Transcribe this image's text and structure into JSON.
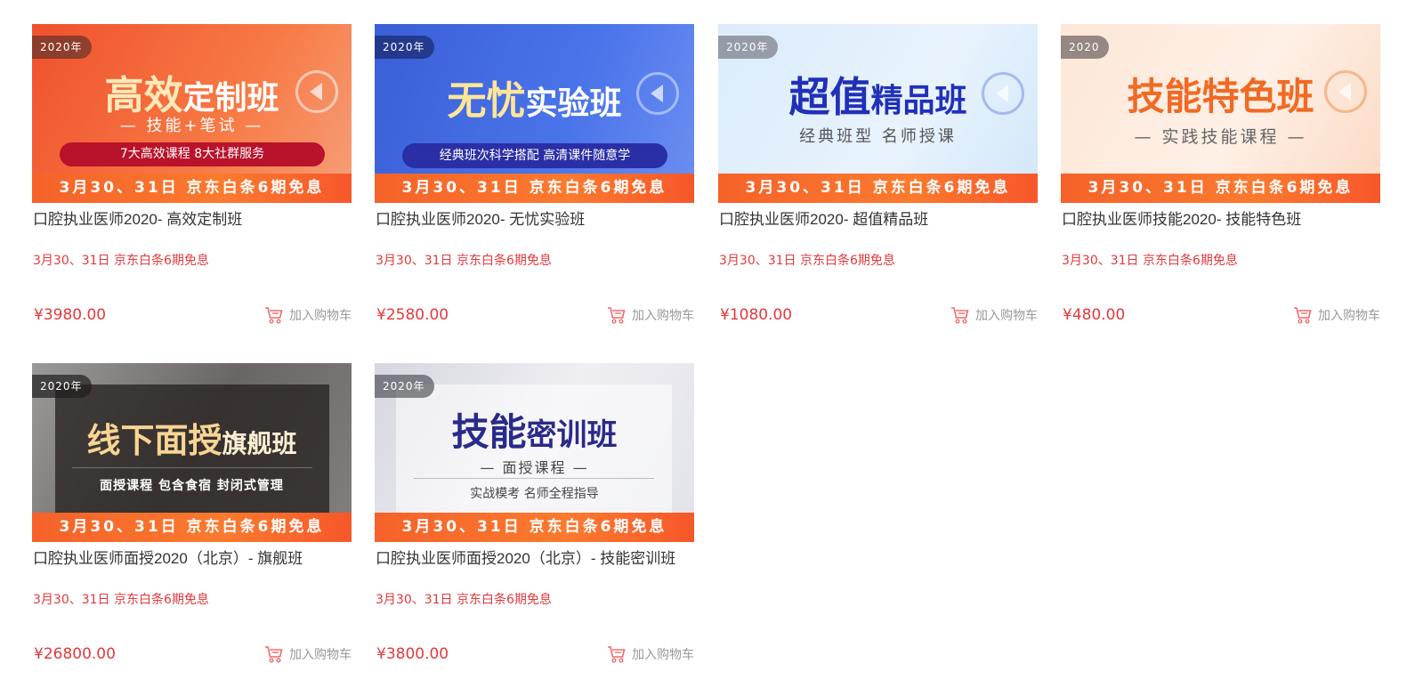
{
  "cards": [
    {
      "year": "2020年",
      "banner_main_a": "高效",
      "banner_main_b": "定制班",
      "banner_sub": "— 技能+笔试 —",
      "banner_pill": "7大高效课程  8大社群服务",
      "banner_promo": "3月30、31日 京东白条6期免息",
      "title": "口腔执业医师2020- 高效定制班",
      "promo": "3月30、31日 京东白条6期免息",
      "price": "¥3980.00",
      "cart": "加入购物车"
    },
    {
      "year": "2020年",
      "banner_main_a": "无忧",
      "banner_main_b": "实验班",
      "banner_pill": "经典班次科学搭配 高清课件随意学",
      "banner_promo": "3月30、31日 京东白条6期免息",
      "title": "口腔执业医师2020- 无忧实验班",
      "promo": "3月30、31日 京东白条6期免息",
      "price": "¥2580.00",
      "cart": "加入购物车"
    },
    {
      "year": "2020年",
      "banner_main_a": "超值",
      "banner_main_b": "精品班",
      "banner_sub": "经典班型   名师授课",
      "banner_promo": "3月30、31日 京东白条6期免息",
      "title": "口腔执业医师2020- 超值精品班",
      "promo": "3月30、31日 京东白条6期免息",
      "price": "¥1080.00",
      "cart": "加入购物车"
    },
    {
      "year": "2020",
      "banner_main_a": "技能特色班",
      "banner_sub": "— 实践技能课程 —",
      "banner_promo": "3月30、31日 京东白条6期免息",
      "title": "口腔执业医师技能2020- 技能特色班",
      "promo": "3月30、31日 京东白条6期免息",
      "price": "¥480.00",
      "cart": "加入购物车"
    },
    {
      "year": "2020年",
      "banner_main_a": "线下面授",
      "banner_main_b": "旗舰班",
      "banner_sub": "面授课程 包含食宿 封闭式管理",
      "banner_promo": "3月30、31日 京东白条6期免息",
      "title": "口腔执业医师面授2020（北京）- 旗舰班",
      "promo": "3月30、31日 京东白条6期免息",
      "price": "¥26800.00",
      "cart": "加入购物车"
    },
    {
      "year": "2020年",
      "banner_main_a": "技能",
      "banner_main_b": "密训班",
      "banner_sub": "— 面授课程 —",
      "banner_pill": "实战模考 名师全程指导",
      "banner_promo": "3月30、31日 京东白条6期免息",
      "title": "口腔执业医师面授2020（北京）- 技能密训班",
      "promo": "3月30、31日 京东白条6期免息",
      "price": "¥3800.00",
      "cart": "加入购物车"
    }
  ],
  "icons": {
    "cart": "shopping-cart-icon",
    "logo": "play-logo-icon"
  },
  "colors": {
    "price": "#e4393c",
    "promo_bar": "#f5622a",
    "muted": "#999999"
  }
}
